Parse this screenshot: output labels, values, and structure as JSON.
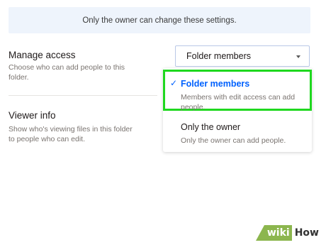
{
  "notice": {
    "text": "Only the owner can change these settings."
  },
  "settings": {
    "manage_access": {
      "title": "Manage access",
      "description": "Choose who can add people to this folder."
    },
    "viewer_info": {
      "title": "Viewer info",
      "description": "Show who's viewing files in this folder to people who can edit."
    }
  },
  "select": {
    "value": "Folder members",
    "caret_icon": "chevron-down-icon"
  },
  "dropdown": {
    "options": [
      {
        "label": "Folder members",
        "description": "Members with edit access can add people.",
        "selected": true,
        "icon": "checkmark-icon"
      },
      {
        "label": "Only the owner",
        "description": "Only the owner can add people.",
        "selected": false
      }
    ]
  },
  "colors": {
    "accent": "#0061fe",
    "highlight": "#1fd81f",
    "notice_bg": "#eef4fc",
    "muted_text": "#7a7470"
  },
  "watermark": {
    "wiki": "wiki",
    "how": "How"
  }
}
